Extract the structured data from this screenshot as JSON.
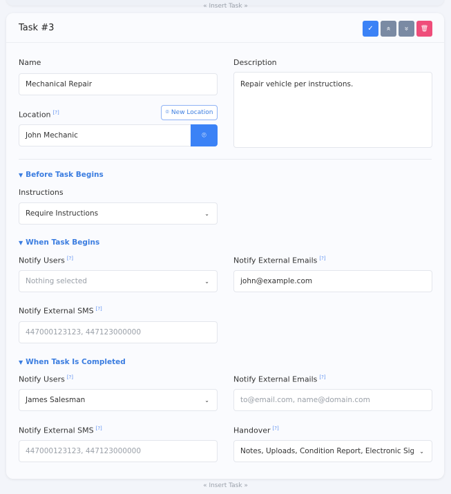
{
  "insert_task_label": "Insert Task",
  "task": {
    "title": "Task #3",
    "buttons": {
      "confirm": "✓",
      "move_up": "«",
      "move_down": "»",
      "delete": "🗑"
    }
  },
  "colors": {
    "accent": "#3b82f6",
    "grey_button": "#7a8aa3",
    "danger": "#ef4d7a"
  },
  "fields": {
    "name": {
      "label": "Name",
      "value": "Mechanical Repair"
    },
    "description": {
      "label": "Description",
      "value": "Repair vehicle per instructions."
    },
    "location": {
      "label": "Location",
      "help": "[?]",
      "new_button": "New Location",
      "value": "John Mechanic"
    }
  },
  "before": {
    "heading": "Before Task Begins",
    "instructions": {
      "label": "Instructions",
      "value": "Require Instructions"
    }
  },
  "when_begins": {
    "heading": "When Task Begins",
    "notify_users": {
      "label": "Notify Users",
      "help": "[?]",
      "placeholder": "Nothing selected"
    },
    "notify_emails": {
      "label": "Notify External Emails",
      "help": "[?]",
      "value": "john@example.com"
    },
    "notify_sms": {
      "label": "Notify External SMS",
      "help": "[?]",
      "placeholder": "447000123123, 447123000000"
    }
  },
  "when_completed": {
    "heading": "When Task Is Completed",
    "notify_users": {
      "label": "Notify Users",
      "help": "[?]",
      "value": "James Salesman"
    },
    "notify_emails": {
      "label": "Notify External Emails",
      "help": "[?]",
      "placeholder": "to@email.com, name@domain.com"
    },
    "notify_sms": {
      "label": "Notify External SMS",
      "help": "[?]",
      "placeholder": "447000123123, 447123000000"
    },
    "handover": {
      "label": "Handover",
      "help": "[?]",
      "value": "Notes, Uploads, Condition Report, Electronic Signatu"
    }
  }
}
